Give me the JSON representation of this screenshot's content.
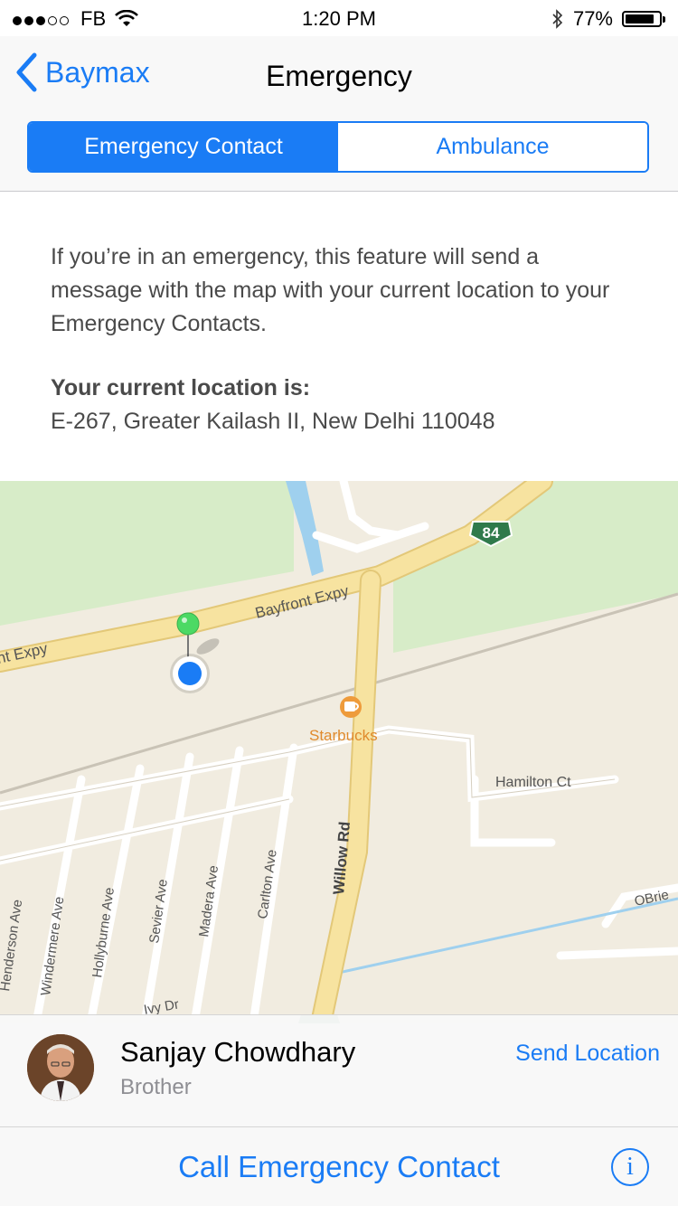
{
  "status_bar": {
    "carrier": "FB",
    "time": "1:20 PM",
    "battery": "77%",
    "battery_level": 0.77,
    "signal_bars_filled": 3,
    "signal_bars_total": 5
  },
  "nav": {
    "back_label": "Baymax",
    "title": "Emergency"
  },
  "segments": {
    "selected": "Emergency Contact",
    "items": [
      "Emergency Contact",
      "Ambulance"
    ]
  },
  "content": {
    "description": "If you’re in an emergency, this feature will send a message with the map with your current location to your Emergency Contacts.",
    "location_label": "Your current location is:",
    "location_value": "E-267, Greater Kailash II, New Delhi 110048"
  },
  "map": {
    "labels": {
      "bayfront_expy": "Bayfront Expy",
      "expy_left": "nt Expy",
      "highway_shield": "84",
      "starbucks": "Starbucks",
      "hamilton": "Hamilton Ct",
      "willow": "Willow Rd",
      "henderson": "Henderson Ave",
      "windermere": "Windermere Ave",
      "hollyburne": "Hollyburne Ave",
      "sevier": "Sevier Ave",
      "madera": "Madera Ave",
      "carlton": "Carlton Ave",
      "obrien": "OBrie",
      "ivy": "Ivy Dr"
    }
  },
  "contact": {
    "name": "Sanjay Chowdhary",
    "relation": "Brother",
    "send_location": "Send Location"
  },
  "call_button": "Call Emergency Contact",
  "colors": {
    "accent": "#1a7cf5",
    "map_bg": "#f1ece0",
    "road_major": "#f7e3a0",
    "park": "#d7ecc8",
    "water": "#9fd0ee"
  }
}
